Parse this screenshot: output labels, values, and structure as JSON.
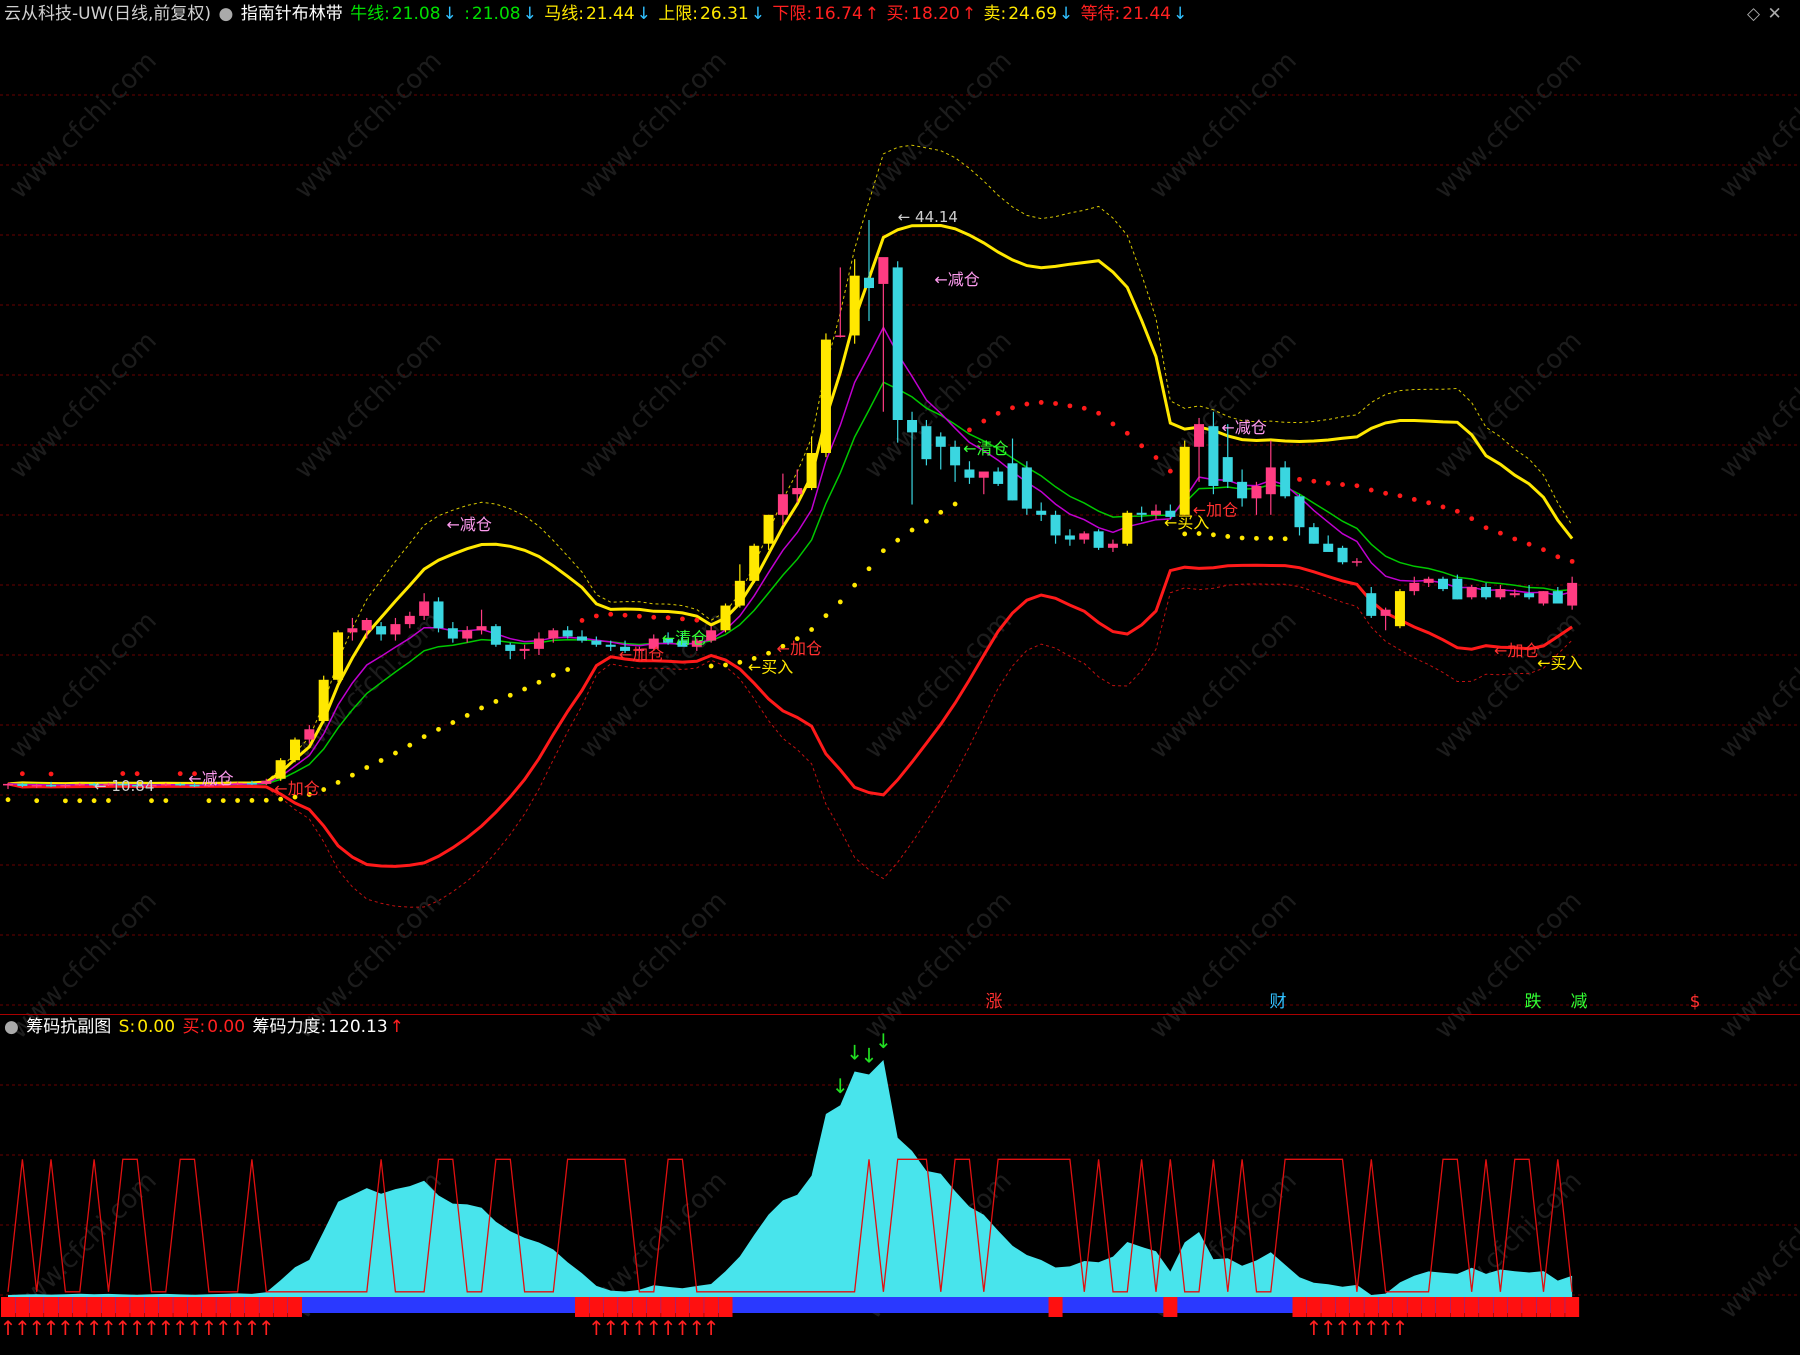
{
  "main_header": {
    "stock": "云从科技-UW(日线,前复权)",
    "indicator": "指南针布林带",
    "niu_label": "牛线:",
    "niu_value": "21.08",
    "blank_label": ":",
    "blank_value": "21.08",
    "ma_label": "马线:",
    "ma_value": "21.44",
    "upper_label": "上限:",
    "upper_value": "26.31",
    "lower_label": "下限:",
    "lower_value": "16.74",
    "buy_label": "买:",
    "buy_value": "18.20",
    "sell_label": "卖:",
    "sell_value": "24.69",
    "wait_label": "等待:",
    "wait_value": "21.44"
  },
  "sub_header": {
    "indicator": "筹码抗副图",
    "s_label": "S:",
    "s_value": "0.00",
    "buy_label": "买:",
    "buy_value": "0.00",
    "force_label": "筹码力度:",
    "force_value": "120.13"
  },
  "colors": {
    "up": "#ff3c82",
    "down": "#3ad6e0",
    "yellow": "#ffe800",
    "red": "#ff1a1a",
    "green": "#00c800",
    "magenta": "#c000d0",
    "area": "#48e4ec",
    "blue": "#2a39ff"
  },
  "chart_data": [
    {
      "type": "candlestick",
      "title": "指南针布林带",
      "candles": [
        [
          10.9,
          11.0,
          10.7,
          10.95
        ],
        [
          10.95,
          11.0,
          10.8,
          10.85
        ],
        [
          10.85,
          10.95,
          10.75,
          10.9
        ],
        [
          10.9,
          11.05,
          10.8,
          10.85
        ],
        [
          10.85,
          10.95,
          10.75,
          10.9
        ],
        [
          10.9,
          11.0,
          10.85,
          10.95
        ],
        [
          10.95,
          11.0,
          10.84,
          10.9
        ],
        [
          10.9,
          11.0,
          10.85,
          10.95
        ],
        [
          10.95,
          11.05,
          10.85,
          10.9
        ],
        [
          10.9,
          11.0,
          10.8,
          10.85
        ],
        [
          10.85,
          10.95,
          10.8,
          10.9
        ],
        [
          10.9,
          11.0,
          10.85,
          10.95
        ],
        [
          10.95,
          11.0,
          10.85,
          10.9
        ],
        [
          10.9,
          11.0,
          10.8,
          10.85
        ],
        [
          10.85,
          10.95,
          10.8,
          10.9
        ],
        [
          10.9,
          11.0,
          10.85,
          10.95
        ],
        [
          10.95,
          11.05,
          10.9,
          11.0
        ],
        [
          11.0,
          11.1,
          10.9,
          10.95
        ],
        [
          10.95,
          11.2,
          10.9,
          11.1
        ],
        [
          11.2,
          12.2,
          11.1,
          12.1
        ],
        [
          12.1,
          13.2,
          12.0,
          13.1
        ],
        [
          13.1,
          13.8,
          12.9,
          13.6
        ],
        [
          14.0,
          16.2,
          13.9,
          16.0
        ],
        [
          16.0,
          18.4,
          15.9,
          18.3
        ],
        [
          18.3,
          19.0,
          17.9,
          18.5
        ],
        [
          18.4,
          19.0,
          18.0,
          18.9
        ],
        [
          18.6,
          18.8,
          17.9,
          18.2
        ],
        [
          18.2,
          19.0,
          17.9,
          18.7
        ],
        [
          18.7,
          19.3,
          18.5,
          19.1
        ],
        [
          19.1,
          20.2,
          18.9,
          19.8
        ],
        [
          19.8,
          20.0,
          18.3,
          18.5
        ],
        [
          18.5,
          18.8,
          17.8,
          18.0
        ],
        [
          18.0,
          18.6,
          17.8,
          18.4
        ],
        [
          18.4,
          19.4,
          18.2,
          18.6
        ],
        [
          18.6,
          18.7,
          17.6,
          17.7
        ],
        [
          17.7,
          17.8,
          17.0,
          17.4
        ],
        [
          17.4,
          17.7,
          17.0,
          17.5
        ],
        [
          17.5,
          18.3,
          17.2,
          18.0
        ],
        [
          18.0,
          18.5,
          17.8,
          18.4
        ],
        [
          18.4,
          18.6,
          18.0,
          18.1
        ],
        [
          18.1,
          18.4,
          17.8,
          17.9
        ],
        [
          17.9,
          18.1,
          17.6,
          17.7
        ],
        [
          17.7,
          17.9,
          17.4,
          17.6
        ],
        [
          17.6,
          17.9,
          17.3,
          17.4
        ],
        [
          17.4,
          17.6,
          17.3,
          17.5
        ],
        [
          17.5,
          18.2,
          17.4,
          18.0
        ],
        [
          18.0,
          18.3,
          17.7,
          17.8
        ],
        [
          17.9,
          18.3,
          17.7,
          17.6
        ],
        [
          17.6,
          18.0,
          17.4,
          17.9
        ],
        [
          17.9,
          18.6,
          17.8,
          18.4
        ],
        [
          18.4,
          19.7,
          18.3,
          19.6
        ],
        [
          19.6,
          21.6,
          19.5,
          20.8
        ],
        [
          20.8,
          22.6,
          20.7,
          22.5
        ],
        [
          22.6,
          24.0,
          22.3,
          24.0
        ],
        [
          24.0,
          26.0,
          23.5,
          25.0
        ],
        [
          25.0,
          26.2,
          24.6,
          25.3
        ],
        [
          25.3,
          27.8,
          25.2,
          27.0
        ],
        [
          27.0,
          32.8,
          26.8,
          32.5
        ],
        [
          32.7,
          36.0,
          32.6,
          32.7
        ],
        [
          32.7,
          36.4,
          32.3,
          35.6
        ],
        [
          35.5,
          38.3,
          33.4,
          35.0
        ],
        [
          35.2,
          35.8,
          29.0,
          36.5
        ],
        [
          36.0,
          36.3,
          27.5,
          28.6
        ],
        [
          28.6,
          29.0,
          24.5,
          28.0
        ],
        [
          28.3,
          28.6,
          26.4,
          26.7
        ],
        [
          27.8,
          28.0,
          26.2,
          27.3
        ],
        [
          27.3,
          27.6,
          25.6,
          26.4
        ],
        [
          26.2,
          26.6,
          25.5,
          25.8
        ],
        [
          25.8,
          26.0,
          25.0,
          26.1
        ],
        [
          26.1,
          26.3,
          25.4,
          25.5
        ],
        [
          26.5,
          27.7,
          24.7,
          24.7
        ],
        [
          26.3,
          26.6,
          24.0,
          24.3
        ],
        [
          24.2,
          24.6,
          23.7,
          24.0
        ],
        [
          24.0,
          24.2,
          22.6,
          23.0
        ],
        [
          23.0,
          23.3,
          22.5,
          22.8
        ],
        [
          22.8,
          23.2,
          22.6,
          23.1
        ],
        [
          23.2,
          23.3,
          22.3,
          22.4
        ],
        [
          22.4,
          22.8,
          22.2,
          22.6
        ],
        [
          22.6,
          24.2,
          22.5,
          24.1
        ],
        [
          24.1,
          24.4,
          23.7,
          24.0
        ],
        [
          24.0,
          24.5,
          23.8,
          24.2
        ],
        [
          24.2,
          24.5,
          23.8,
          23.9
        ],
        [
          24.0,
          27.6,
          24.0,
          27.3
        ],
        [
          27.3,
          28.7,
          25.6,
          28.4
        ],
        [
          28.3,
          29.0,
          25.0,
          25.4
        ],
        [
          26.8,
          28.4,
          25.3,
          25.6
        ],
        [
          25.6,
          26.2,
          24.4,
          24.8
        ],
        [
          24.8,
          25.6,
          24.0,
          25.4
        ],
        [
          25.0,
          27.6,
          24.0,
          26.3
        ],
        [
          26.3,
          26.6,
          24.8,
          24.9
        ],
        [
          24.9,
          25.0,
          23.0,
          23.4
        ],
        [
          23.4,
          23.6,
          22.6,
          22.6
        ],
        [
          22.6,
          23.0,
          22.3,
          22.2
        ],
        [
          22.4,
          22.5,
          21.6,
          21.7
        ],
        [
          21.7,
          21.9,
          21.5,
          21.75
        ],
        [
          20.2,
          20.5,
          19.0,
          19.1
        ],
        [
          19.1,
          19.5,
          18.4,
          19.4
        ],
        [
          18.6,
          20.4,
          18.5,
          20.3
        ],
        [
          20.3,
          21.0,
          20.1,
          20.7
        ],
        [
          20.7,
          21.0,
          20.5,
          20.9
        ],
        [
          20.9,
          21.0,
          20.3,
          20.4
        ],
        [
          20.9,
          21.1,
          19.9,
          19.9
        ],
        [
          20.0,
          20.6,
          19.9,
          20.5
        ],
        [
          20.5,
          20.7,
          19.9,
          20.0
        ],
        [
          20.0,
          20.6,
          19.9,
          20.4
        ],
        [
          20.1,
          20.4,
          20.0,
          20.2
        ],
        [
          20.2,
          20.6,
          19.9,
          20.0
        ],
        [
          19.7,
          20.3,
          19.6,
          20.3
        ],
        [
          20.3,
          20.5,
          19.7,
          19.7
        ],
        [
          19.6,
          21.0,
          19.4,
          20.7
        ]
      ],
      "max_label": "44.14",
      "min_label": "10.84",
      "signal_labels": [
        "←减仓",
        "←减仓",
        "←加仓",
        "←清仓",
        "←加仓",
        "←买入",
        "←加仓",
        "←减仓",
        "←清仓",
        "←减仓",
        "←加仓",
        "←买入",
        "←加仓",
        "←买入"
      ],
      "bottom_labels": [
        "涨",
        "财",
        "跌",
        "减",
        "$"
      ]
    },
    {
      "type": "area",
      "title": "筹码抗副图"
    }
  ]
}
